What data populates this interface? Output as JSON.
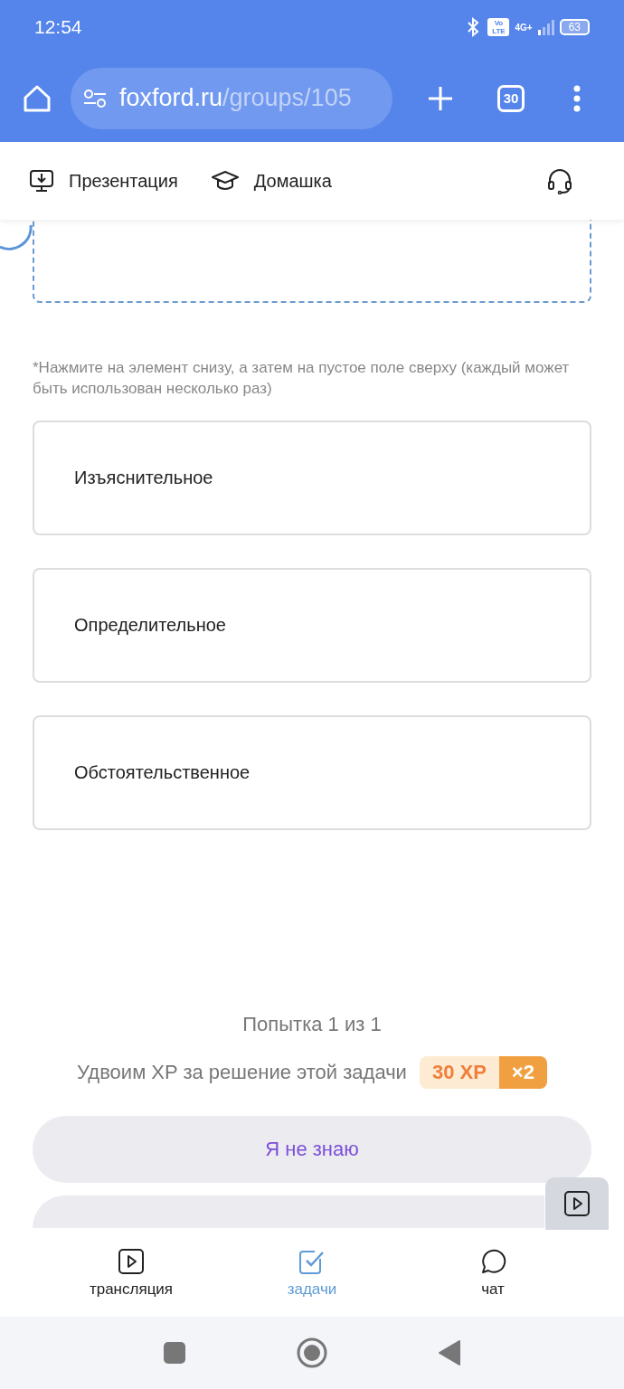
{
  "status_bar": {
    "time": "12:54",
    "volte": "Vo LTE",
    "network": "4G+",
    "battery": "63"
  },
  "browser": {
    "url_host": "foxford.ru",
    "url_path": "/groups/105",
    "tab_count": "30"
  },
  "header": {
    "items": [
      {
        "kind": "presentation",
        "label": "Презентация"
      },
      {
        "kind": "homework",
        "label": "Домашка"
      }
    ]
  },
  "task": {
    "hint": "*Нажмите на элемент снизу, а затем на пустое поле сверху (каждый может быть использован несколько раз)",
    "options": [
      {
        "label": "Изъяснительное"
      },
      {
        "label": "Определительное"
      },
      {
        "label": "Обстоятельственное"
      }
    ],
    "attempt": "Попытка 1 из 1",
    "xp": {
      "text": "Удвоим XP за решение этой задачи",
      "amount": "30 XP",
      "multiplier": "×2"
    },
    "buttons": [
      {
        "kind": "secondary",
        "label": "Я не знаю"
      }
    ]
  },
  "bottom_nav": [
    {
      "kind": "stream",
      "label": "трансляция",
      "selected": false
    },
    {
      "kind": "tasks",
      "label": "задачи",
      "selected": true
    },
    {
      "kind": "chat",
      "label": "чат",
      "selected": false
    }
  ]
}
